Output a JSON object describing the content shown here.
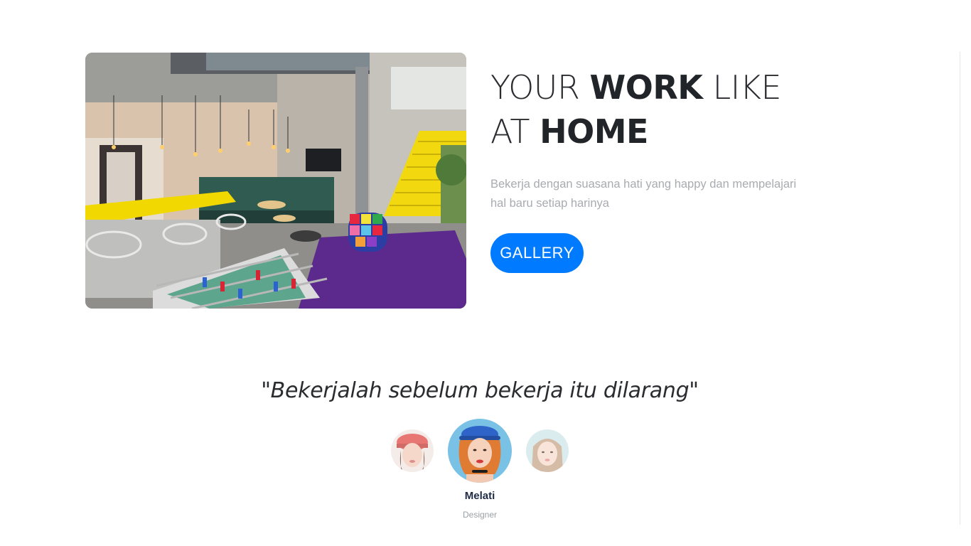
{
  "hero": {
    "title_parts": [
      "YOUR",
      "WORK",
      "LIKE",
      "AT",
      "HOME"
    ],
    "subtitle": "Bekerja dengan suasana hati yang happy dan mempelajari hal baru setiap harinya",
    "button_label": "GALLERY",
    "image_description_icon": "office-lounge-photo"
  },
  "testimonial": {
    "quote": "\"Bekerjalah sebelum bekerja itu dilarang\"",
    "active_person": {
      "name": "Melati",
      "role": "Designer"
    }
  },
  "colors": {
    "accent": "#007bff",
    "title": "#212529",
    "subtitle": "#a8abb0",
    "name": "#1f2a44"
  }
}
